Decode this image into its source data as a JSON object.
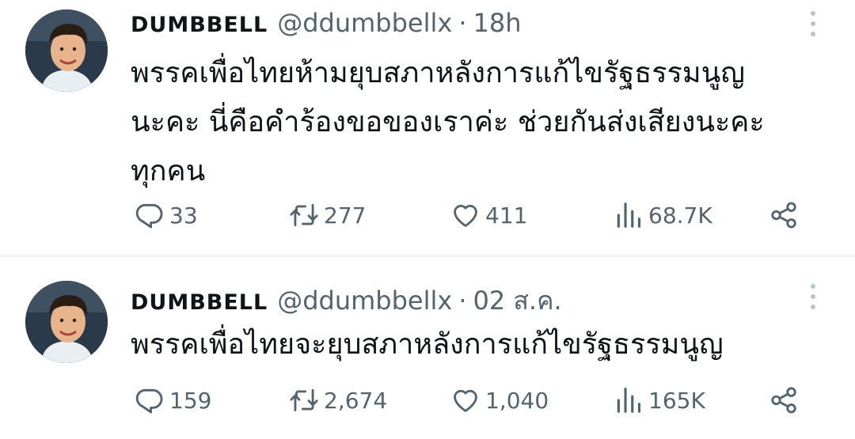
{
  "tweets": [
    {
      "display_name": "DUMBBELL",
      "handle": "@ddumbbellx",
      "separator": "·",
      "time": "18h",
      "avatar_icon": "profile-photo",
      "text": "พรรคเพื่อไทยห้ามยุบสภาหลังการแก้ไขรัฐธรรมนูญ\nนะคะ นี่คือคำร้องขอของเราค่ะ ช่วยกันส่งเสียงนะคะ\nทุกคน",
      "replies": "33",
      "retweets": "277",
      "likes": "411",
      "views": "68.7K"
    },
    {
      "display_name": "DUMBBELL",
      "handle": "@ddumbbellx",
      "separator": "·",
      "time": "02 ส.ค.",
      "avatar_icon": "profile-photo",
      "text": "พรรคเพื่อไทยจะยุบสภาหลังการแก้ไขรัฐธรรมนูญ",
      "replies": "159",
      "retweets": "2,674",
      "likes": "1,040",
      "views": "165K"
    }
  ],
  "icons": {
    "reply": "reply-icon",
    "retweet": "retweet-icon",
    "like": "heart-icon",
    "views": "views-icon",
    "share": "share-icon",
    "more": "more-icon"
  },
  "colors": {
    "text_primary": "#0f1419",
    "text_secondary": "#536471",
    "divider": "#eff3f4"
  }
}
